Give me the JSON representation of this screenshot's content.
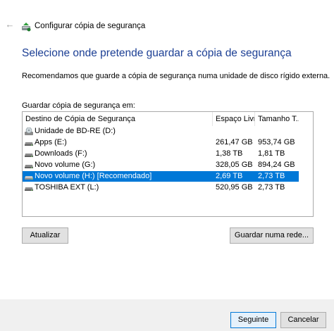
{
  "window": {
    "title": "Configurar cópia de segurança"
  },
  "heading": "Selecione onde pretende guardar a cópia de segurança",
  "recommendation": "Recomendamos que guarde a cópia de segurança numa unidade de disco rígido externa.",
  "list_label": "Guardar cópia de segurança em:",
  "list": {
    "columns": [
      "Destino de Cópia de Segurança",
      "Espaço Livre",
      "Tamanho T..."
    ],
    "rows": [
      {
        "name": "Unidade de BD-RE (D:)",
        "free": "",
        "total": "",
        "icon": "optical-drive-icon",
        "selected": false
      },
      {
        "name": "Apps (E:)",
        "free": "261,47 GB",
        "total": "953,74 GB",
        "icon": "hard-drive-icon",
        "selected": false
      },
      {
        "name": "Downloads (F:)",
        "free": "1,38 TB",
        "total": "1,81 TB",
        "icon": "hard-drive-icon",
        "selected": false
      },
      {
        "name": "Novo volume (G:)",
        "free": "328,05 GB",
        "total": "894,24 GB",
        "icon": "hard-drive-icon",
        "selected": false
      },
      {
        "name": "Novo volume (H:) [Recomendado]",
        "free": "2,69 TB",
        "total": "2,73 TB",
        "icon": "hard-drive-icon",
        "selected": true
      },
      {
        "name": "TOSHIBA EXT (L:)",
        "free": "520,95 GB",
        "total": "2,73 TB",
        "icon": "hard-drive-icon",
        "selected": false
      }
    ]
  },
  "buttons": {
    "refresh": "Atualizar",
    "network": "Guardar numa rede...",
    "next": "Seguinte",
    "cancel": "Cancelar"
  },
  "colors": {
    "heading": "#1c3f94",
    "selection": "#0078d7",
    "footer": "#f0f0f0"
  }
}
